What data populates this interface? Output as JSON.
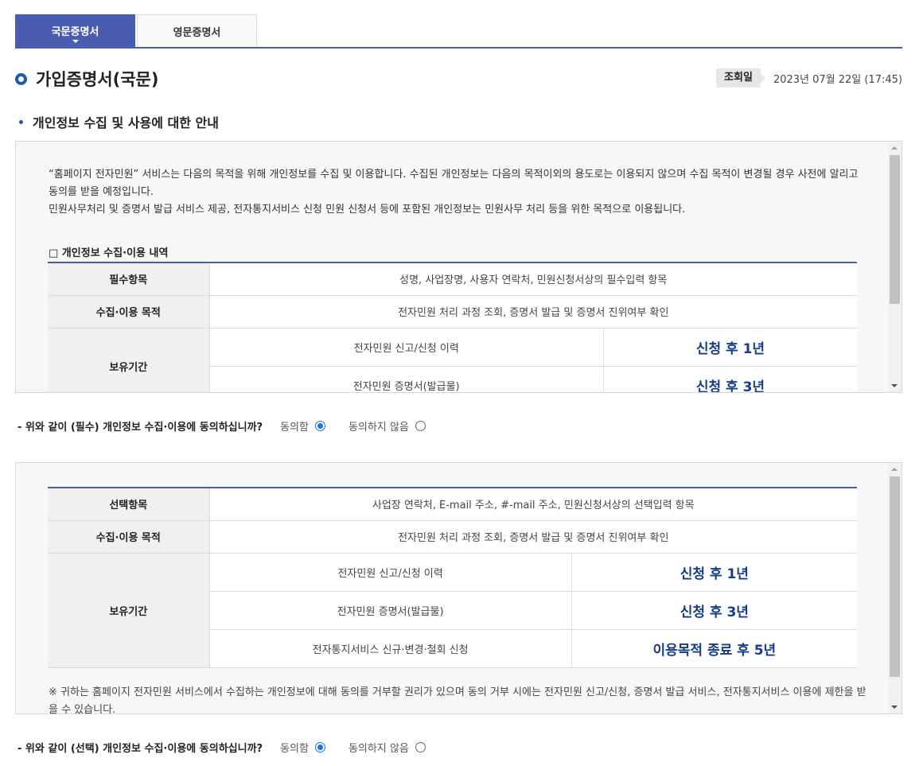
{
  "tabs": [
    {
      "label": "국문증명서",
      "active": true
    },
    {
      "label": "영문증명서",
      "active": false
    }
  ],
  "title": "가입증명서(국문)",
  "query_date": {
    "label": "조회일",
    "value": "2023년 07월 22일 (17:45)"
  },
  "section_heading": "개인정보 수집 및 사용에 대한 안내",
  "required_box": {
    "intro": [
      "“홈페이지 전자민원” 서비스는 다음의 목적을 위해 개인정보를 수집 및 이용합니다. 수집된 개인정보는 다음의 목적이외의 용도로는 이용되지 않으며 수집 목적이 변경될 경우 사전에 알리고 동의를 받을 예정입니다.",
      "민원사무처리 및 증명서 발급 서비스 제공, 전자통지서비스 신청 민원 신청서 등에 포함된 개인정보는 민원사무 처리 등을 위한 목적으로 이용됩니다."
    ],
    "list_title": "□ 개인정보 수집·이용 내역",
    "items_label": "필수항목",
    "items_value": "성명, 사업장명, 사용자 연락처, 민원신청서상의 필수입력 항목",
    "purpose_label": "수집·이용 목적",
    "purpose_value": "전자민원 처리 과정 조회, 증명서 발급 및 증명서 진위여부 확인",
    "retention_label": "보유기간",
    "retention": [
      {
        "item": "전자민원 신고/신청 이력",
        "period": "신청 후 1년"
      },
      {
        "item": "전자민원 증명서(발급물)",
        "period": "신청 후 3년"
      }
    ]
  },
  "consent_required": {
    "question": "- 위와 같이 (필수) 개인정보 수집·이용에 동의하십니까?",
    "agree": "동의함",
    "disagree": "동의하지 않음",
    "selected": "agree"
  },
  "optional_box": {
    "items_label": "선택항목",
    "items_value": "사업장 연락처, E-mail 주소, #-mail 주소, 민원신청서상의 선택입력 항목",
    "purpose_label": "수집·이용 목적",
    "purpose_value": "전자민원 처리 과정 조회, 증명서 발급 및 증명서 진위여부 확인",
    "retention_label": "보유기간",
    "retention": [
      {
        "item": "전자민원 신고/신청 이력",
        "period": "신청 후 1년"
      },
      {
        "item": "전자민원 증명서(발급물)",
        "period": "신청 후 3년"
      },
      {
        "item": "전자통지서비스 신규·변경·철회 신청",
        "period": "이용목적 종료 후 5년"
      }
    ],
    "note": "※ 귀하는 홈페이지 전자민원 서비스에서 수집하는 개인정보에 대해 동의를 거부할 권리가 있으며 동의 거부 시에는 전자민원 신고/신청, 증명서 발급 서비스, 전자통지서비스 이용에 제한을 받을 수 있습니다."
  },
  "consent_optional": {
    "question": "- 위와 같이 (선택) 개인정보 수집·이용에 동의하십니까?",
    "agree": "동의함",
    "disagree": "동의하지 않음",
    "selected": "agree"
  },
  "colors": {
    "accent": "#4a5cb0",
    "period_text": "#153c8c",
    "radio": "#1a73e8"
  }
}
